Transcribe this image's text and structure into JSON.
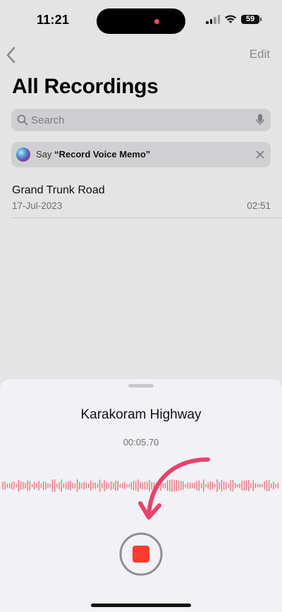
{
  "status_bar": {
    "time": "11:21",
    "battery": "59"
  },
  "nav": {
    "edit_label": "Edit"
  },
  "page_title": "All Recordings",
  "search": {
    "placeholder": "Search"
  },
  "siri_banner": {
    "prefix": "Say ",
    "phrase": "“Record Voice Memo”"
  },
  "recordings": [
    {
      "title": "Grand Trunk Road",
      "date": "17-Jul-2023",
      "duration": "02:51"
    }
  ],
  "recording_sheet": {
    "title": "Karakoram Highway",
    "elapsed": "00:05.70"
  },
  "colors": {
    "accent_red": "#ff3b30",
    "arrow_pink": "#e8436b",
    "waveform": "#e66a6a"
  },
  "icons": [
    "back-chevron-icon",
    "search-icon",
    "microphone-icon",
    "siri-icon",
    "close-icon",
    "stop-icon",
    "arrow-icon"
  ]
}
